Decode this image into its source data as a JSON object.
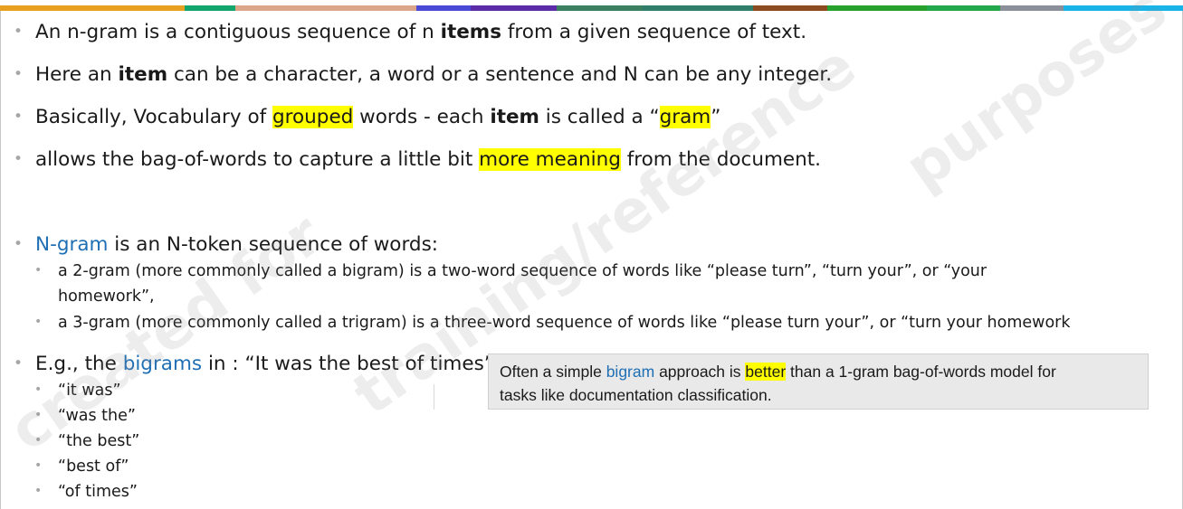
{
  "accent_colors": [
    "#e8a020",
    "#13a56e",
    "#dba58a",
    "#4a4ad6",
    "#5c2ca8",
    "#3a8060",
    "#2f7d6a",
    "#8b4a20",
    "#27a12b",
    "#22a84a",
    "#8a8f9a",
    "#1ab3e8"
  ],
  "highlight_color": "#ffff00",
  "link_color": "#1f6fb5",
  "bullets": {
    "b1": {
      "t1": "An n-gram is a contiguous sequence of n ",
      "t2": "items",
      "t3": " from a given sequence of text."
    },
    "b2": {
      "t1": "Here an ",
      "t2": "item",
      "t3": " can be a character, a word or a sentence and N can be any integer."
    },
    "b3": {
      "t1": "Basically, Vocabulary of ",
      "t2": "grouped",
      "t3": " words - each ",
      "t4": "item",
      "t5": " is called a “",
      "t6": "gram",
      "t7": "”"
    },
    "b4": {
      "t1": "allows the bag-of-words to capture a little bit ",
      "t2": "more meaning",
      "t3": " from the document."
    },
    "b5": {
      "t1": "N-gram",
      "t2": " is an N-token sequence of words:"
    },
    "b5_sub": [
      {
        "line1": "a 2-gram (more commonly called a bigram) is a two-word sequence of words like “please turn”, “turn your”, or “your",
        "line2": "homework”,"
      },
      {
        "line1": "a 3-gram (more commonly called a trigram) is a three-word sequence of words like “please turn your”, or “turn your homework"
      }
    ],
    "b6": {
      "t1": "E.g., the ",
      "t2": "bigrams",
      "t3": " in : “It was the best of times”"
    },
    "b6_sub": [
      "“it was”",
      "“was the”",
      "“the best”",
      "“best of”",
      "“of times”"
    ]
  },
  "callout": {
    "t1": "Often a simple ",
    "t2": "bigram",
    "t3": " approach is ",
    "t4": "better",
    "t5": " than a 1-gram bag-of-words model for",
    "line2": "tasks like documentation classification."
  },
  "watermark": {
    "w1": "created for",
    "w2": "training/reference",
    "w3": "purposes"
  },
  "bullet_glyph": "•"
}
